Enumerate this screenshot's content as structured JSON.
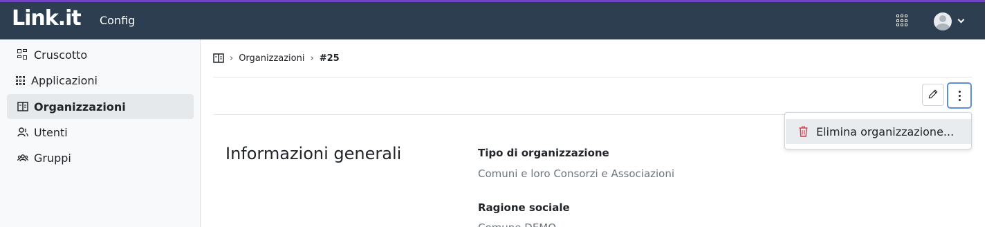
{
  "header": {
    "logo_text": "Link.it",
    "app_name": "Config",
    "apps_icon": "grid-icon",
    "user_icon": "avatar-icon",
    "bg_color": "#2c3e50",
    "accent_color": "#6f42c1"
  },
  "sidebar": {
    "items": [
      {
        "label": "Cruscotto",
        "icon": "dashboard-icon",
        "active": false
      },
      {
        "label": "Applicazioni",
        "icon": "grid-icon",
        "active": false
      },
      {
        "label": "Organizzazioni",
        "icon": "building-icon",
        "active": true
      },
      {
        "label": "Utenti",
        "icon": "users-icon",
        "active": false
      },
      {
        "label": "Gruppi",
        "icon": "groups-icon",
        "active": false
      }
    ]
  },
  "breadcrumb": {
    "icon": "building-icon",
    "items": [
      "Organizzazioni",
      "#25"
    ],
    "separator": "›"
  },
  "toolbar": {
    "edit_icon": "pencil-icon",
    "more_icon": "kebab-menu-icon"
  },
  "dropdown": {
    "items": [
      {
        "label": "Elimina organizzazione...",
        "icon": "trash-icon",
        "icon_color": "#dc3545"
      }
    ]
  },
  "content": {
    "section_title": "Informazioni generali",
    "fields": [
      {
        "label": "Tipo di organizzazione",
        "value": "Comuni e loro Consorzi e Associazioni"
      },
      {
        "label": "Ragione sociale",
        "value": "Comune DEMO"
      }
    ]
  }
}
